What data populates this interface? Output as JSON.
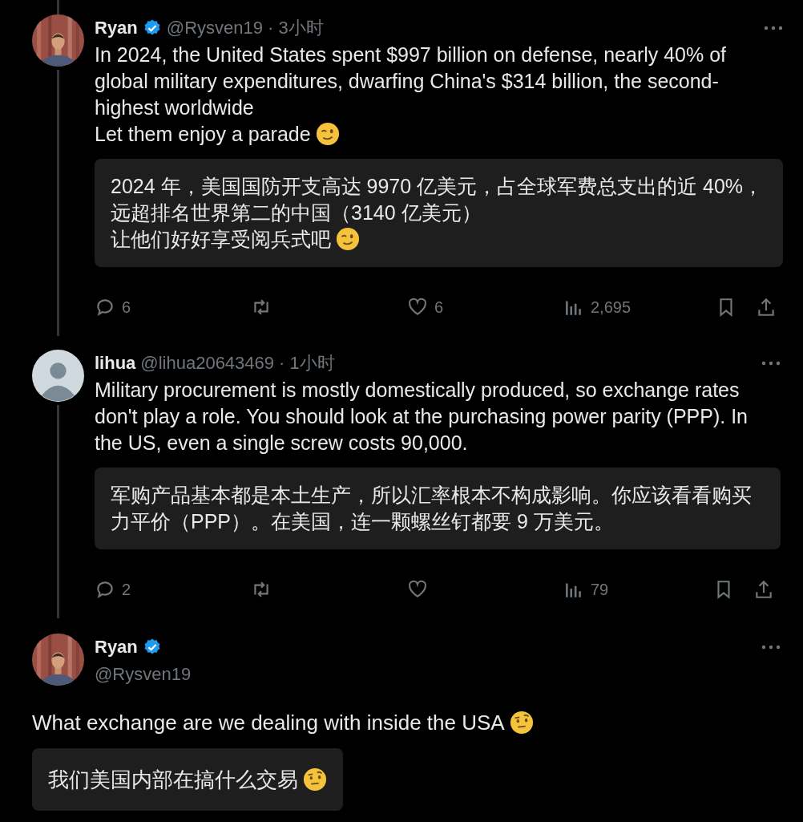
{
  "thread": [
    {
      "kind": "reply",
      "default_avatar": false,
      "name": "Ryan",
      "verified": true,
      "handle": "@Rysven19",
      "time": "· 3小时",
      "text": "In 2024, the United States spent $997 billion on defense, nearly 40% of global military expenditures, dwarfing China's $314 billion, the second-highest worldwide\nLet them enjoy a parade",
      "wink_emoji": true,
      "translation": [
        "2024 年，美国国防开支高达 9970 亿美元，占全球军费总支出的近 40%，",
        "远超排名世界第二的中国（3140 亿美元）",
        "让他们好好享受阅兵式吧"
      ],
      "translation_wink_emoji": true,
      "actions": {
        "replies": "6",
        "likes": "6",
        "views": "2,695"
      }
    },
    {
      "kind": "reply",
      "default_avatar": true,
      "name": "lihua",
      "verified": false,
      "handle": "@lihua20643469",
      "time": "· 1小时",
      "text": "Military procurement is mostly domestically produced, so exchange rates don't play a role. You should look at the purchasing power parity (PPP). In the US, even a single screw costs 90,000.",
      "translation": [
        "军购产品基本都是本土生产，所以汇率根本不构成影响。你应该看看购买",
        "力平价（PPP）。在美国，连一颗螺丝钉都要 9 万美元。"
      ],
      "actions": {
        "replies": "2",
        "views": "79"
      }
    },
    {
      "kind": "focal",
      "default_avatar": false,
      "name": "Ryan",
      "verified": true,
      "handle": "@Rysven19",
      "text": "What exchange are we dealing with inside the USA",
      "eyebrow_emoji": true,
      "translation": [
        "我们美国内部在搞什么交易"
      ],
      "translation_eyebrow_emoji": true
    }
  ]
}
